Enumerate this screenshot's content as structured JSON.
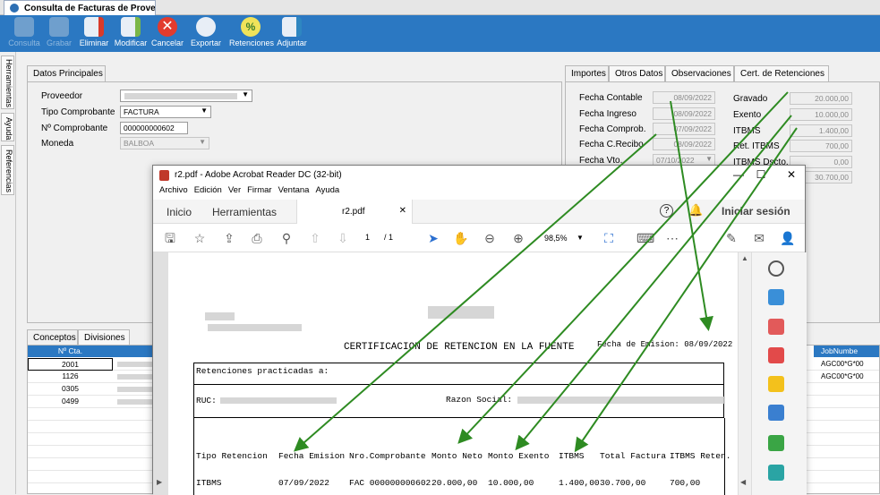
{
  "window_tab": {
    "title": "Consulta de Facturas de Proveed..."
  },
  "toolbar": [
    {
      "label": "Consulta",
      "disabled": true
    },
    {
      "label": "Grabar",
      "disabled": true
    },
    {
      "label": "Eliminar",
      "disabled": false
    },
    {
      "label": "Modificar",
      "disabled": false
    },
    {
      "label": "Cancelar",
      "disabled": false
    },
    {
      "label": "Exportar",
      "disabled": false
    },
    {
      "label": "Retenciones",
      "disabled": false
    },
    {
      "label": "Adjuntar",
      "disabled": false
    }
  ],
  "sidebar": {
    "tabs": [
      "Herramientas",
      "Ayuda",
      "Referencias"
    ]
  },
  "datos_principales": {
    "tab": "Datos Principales",
    "proveedor_label": "Proveedor",
    "tipo_label": "Tipo Comprobante",
    "tipo_value": "FACTURA",
    "num_label": "Nº Comprobante",
    "num_value": "000000000602",
    "moneda_label": "Moneda",
    "moneda_value": "BALBOA"
  },
  "right_tabs": [
    "Importes",
    "Otros Datos",
    "Observaciones",
    "Cert. de Retenciones"
  ],
  "importes": {
    "fecha_contable_label": "Fecha Contable",
    "fecha_contable": "08/09/2022",
    "fecha_ingreso_label": "Fecha Ingreso",
    "fecha_ingreso": "08/09/2022",
    "fecha_comprob_label": "Fecha Comprob.",
    "fecha_comprob": "07/09/2022",
    "fecha_recibo_label": "Fecha C.Recibo",
    "fecha_recibo": "08/09/2022",
    "fecha_vto_label": "Fecha Vto.",
    "fecha_vto": "07/10/2022",
    "gravado_label": "Gravado",
    "gravado": "20.000,00",
    "exento_label": "Exento",
    "exento": "10.000,00",
    "itbms_label": "ITBMS",
    "itbms": "1.400,00",
    "ret_itbms_label": "Ret. ITBMS",
    "ret_itbms": "700,00",
    "itbms_dscto_label": "ITBMS Dscto.",
    "itbms_dscto": "0,00",
    "total": "30.700,00"
  },
  "bottom_tabs": [
    "Conceptos",
    "Divisiones"
  ],
  "conceptos": {
    "col_header": "Nº Cta.",
    "rows": [
      "2001",
      "1126",
      "0305",
      "0499"
    ]
  },
  "jobnumber": {
    "header": "JobNumbe",
    "rows": [
      "AGC00*G*00",
      "AGC00*G*00"
    ]
  },
  "acrobat": {
    "title": "r2.pdf - Adobe Acrobat Reader DC (32-bit)",
    "menu": [
      "Archivo",
      "Edición",
      "Ver",
      "Firmar",
      "Ventana",
      "Ayuda"
    ],
    "tab_inicio": "Inicio",
    "tab_herramientas": "Herramientas",
    "tab_doc": "r2.pdf",
    "iniciar": "Iniciar sesión",
    "page_num": "1",
    "page_total": "/ 1",
    "zoom": "98,5%",
    "doc": {
      "heading": "CERTIFICACION DE RETENCION EN LA FUENTE",
      "fecha_emision": "Fecha de Emision: 08/09/2022",
      "retenciones_a": "Retenciones practicadas a:",
      "ruc_label": "RUC:",
      "razon_label": "Razon Social:",
      "headers": [
        "Tipo Retencion",
        "Fecha Emision",
        "Nro.Comprobante",
        "Monto Neto",
        "Monto Exento",
        "ITBMS",
        "Total Factura",
        "ITBMS Reten."
      ],
      "row": [
        "ITBMS",
        "07/09/2022",
        "FAC 000000000602",
        "20.000,00",
        "10.000,00",
        "1.400,00",
        "30.700,00",
        "700,00"
      ]
    }
  }
}
